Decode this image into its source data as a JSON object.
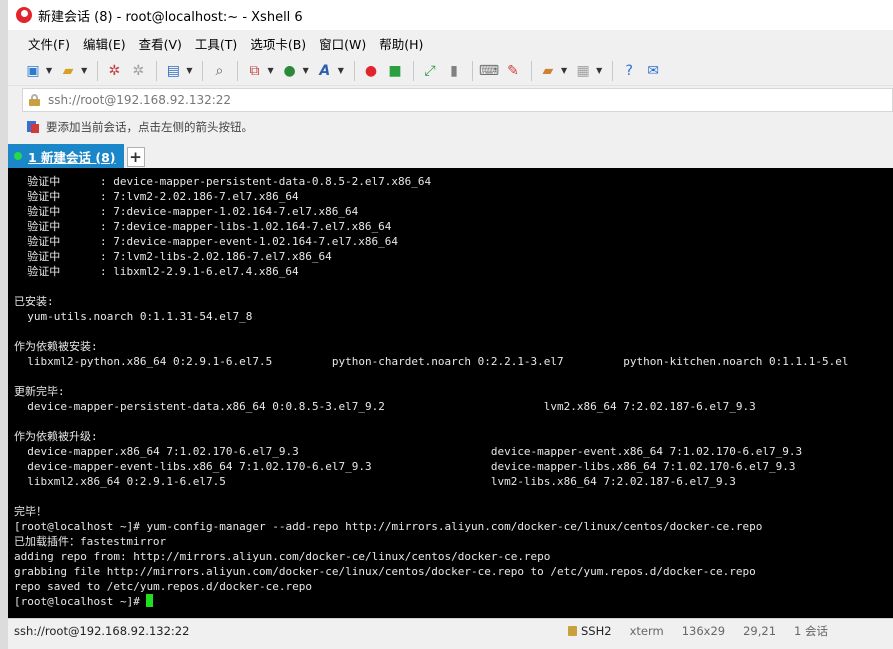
{
  "window": {
    "title": "新建会话 (8) - root@localhost:~ - Xshell 6"
  },
  "menu": [
    "文件(F)",
    "编辑(E)",
    "查看(V)",
    "工具(T)",
    "选项卡(B)",
    "窗口(W)",
    "帮助(H)"
  ],
  "toolbar_icons": [
    "new-session-icon",
    "open-folder-icon",
    "connect-icon",
    "disconnect-icon",
    "properties-icon",
    "find-icon",
    "transfer-icon",
    "globe-icon",
    "font-icon",
    "xshell-icon",
    "xftp-icon",
    "fullscreen-icon",
    "lock-icon",
    "keyboard-icon",
    "highlight-icon",
    "compose-icon",
    "layout-icon",
    "help-icon",
    "chat-icon"
  ],
  "address": {
    "value": "ssh://root@192.168.92.132:22"
  },
  "hint": {
    "text": "要添加当前会话，点击左侧的箭头按钮。"
  },
  "tab": {
    "label": "1 新建会话 (8)",
    "add": "+"
  },
  "terminal": {
    "lines": [
      "  验证中      : device-mapper-persistent-data-0.8.5-2.el7.x86_64",
      "  验证中      : 7:lvm2-2.02.186-7.el7.x86_64",
      "  验证中      : 7:device-mapper-1.02.164-7.el7.x86_64",
      "  验证中      : 7:device-mapper-libs-1.02.164-7.el7.x86_64",
      "  验证中      : 7:device-mapper-event-1.02.164-7.el7.x86_64",
      "  验证中      : 7:lvm2-libs-2.02.186-7.el7.x86_64",
      "  验证中      : libxml2-2.9.1-6.el7.4.x86_64",
      "",
      "已安装:",
      "  yum-utils.noarch 0:1.1.31-54.el7_8",
      "",
      "作为依赖被安装:",
      "  libxml2-python.x86_64 0:2.9.1-6.el7.5         python-chardet.noarch 0:2.2.1-3.el7         python-kitchen.noarch 0:1.1.1-5.el",
      "",
      "更新完毕:",
      "  device-mapper-persistent-data.x86_64 0:0.8.5-3.el7_9.2                        lvm2.x86_64 7:2.02.187-6.el7_9.3",
      "",
      "作为依赖被升级:",
      "  device-mapper.x86_64 7:1.02.170-6.el7_9.3                             device-mapper-event.x86_64 7:1.02.170-6.el7_9.3",
      "  device-mapper-event-libs.x86_64 7:1.02.170-6.el7_9.3                  device-mapper-libs.x86_64 7:1.02.170-6.el7_9.3",
      "  libxml2.x86_64 0:2.9.1-6.el7.5                                        lvm2-libs.x86_64 7:2.02.187-6.el7_9.3",
      "",
      "完毕！",
      "[root@localhost ~]# yum-config-manager --add-repo http://mirrors.aliyun.com/docker-ce/linux/centos/docker-ce.repo",
      "已加载插件：fastestmirror",
      "adding repo from: http://mirrors.aliyun.com/docker-ce/linux/centos/docker-ce.repo",
      "grabbing file http://mirrors.aliyun.com/docker-ce/linux/centos/docker-ce.repo to /etc/yum.repos.d/docker-ce.repo",
      "repo saved to /etc/yum.repos.d/docker-ce.repo"
    ],
    "prompt": "[root@localhost ~]# "
  },
  "status": {
    "connection": "ssh://root@192.168.92.132:22",
    "protocol": "SSH2",
    "terminal_type": "xterm",
    "size": "136x29",
    "position": "29,21",
    "sessions": "1 会话"
  },
  "colors": {
    "tab_active": "#1b86c8",
    "terminal_bg": "#000000",
    "cursor": "#1fe01f",
    "status_dot": "#27d84a"
  }
}
